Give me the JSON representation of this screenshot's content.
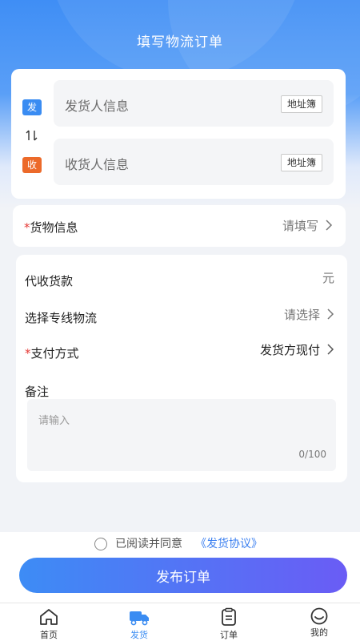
{
  "header": {
    "title": "填写物流订单"
  },
  "address": {
    "sender_badge": "发",
    "sender_placeholder": "发货人信息",
    "receiver_badge": "收",
    "receiver_placeholder": "收货人信息",
    "address_book_label": "地址簿",
    "swap_glyph": "⇅"
  },
  "goods": {
    "required_mark": "*",
    "label": "货物信息",
    "value": "请填写"
  },
  "form": {
    "cod_label": "代收货款",
    "cod_unit": "元",
    "line_label": "选择专线物流",
    "line_value": "请选择",
    "pay_required_mark": "*",
    "pay_label": "支付方式",
    "pay_value": "发货方现付",
    "remark_label": "备注",
    "remark_placeholder": "请输入",
    "remark_count": "0/100"
  },
  "agreement": {
    "text": "已阅读并同意",
    "link": "《发货协议》"
  },
  "actions": {
    "publish_label": "发布订单"
  },
  "tabbar": {
    "items": [
      {
        "label": "首页",
        "icon": "home-icon"
      },
      {
        "label": "发货",
        "icon": "truck-icon"
      },
      {
        "label": "订单",
        "icon": "clipboard-icon"
      },
      {
        "label": "我的",
        "icon": "smile-icon"
      }
    ],
    "active_index": 1
  },
  "colors": {
    "primary": "#3a8cf2",
    "sender_badge": "#3a8cf2",
    "receiver_badge": "#ec6a2a",
    "required": "#e53935",
    "link": "#3a7ff0"
  }
}
